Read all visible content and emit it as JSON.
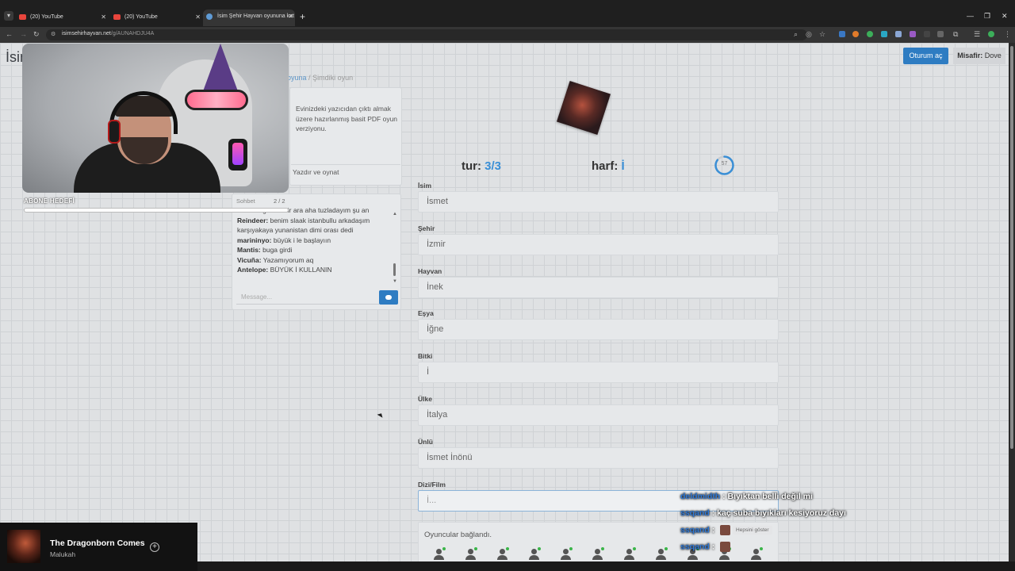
{
  "browser": {
    "tabs": [
      {
        "label": "(20) YouTube"
      },
      {
        "label": "(20) YouTube"
      },
      {
        "label": "İsim Şehir Hayvan oyununa kat"
      }
    ],
    "url_domain": "isimsehirhayvan.net",
    "url_path": "/g/AUNAHDJU4A"
  },
  "site": {
    "brand": "İsim",
    "login_label": "Oturum aç",
    "guest_prefix": "Misafir:",
    "guest_name": "Dove"
  },
  "breadcrumb": {
    "link": "oyuna",
    "separator": "/",
    "current": "Şimdiki oyun"
  },
  "pdf_card": {
    "text": "Evinizdeki yazıcıdan çıktı almak üzere hazırlanmış basit PDF oyun verziyonu.",
    "button": "Yazdır ve oynat"
  },
  "game": {
    "round_label": "tur:",
    "round_value": "3/3",
    "letter_label": "harf:",
    "letter_value": "İ",
    "timer": "57",
    "timer_fraction": 0.85,
    "fields": [
      {
        "label": "İsim",
        "value": "İsmet"
      },
      {
        "label": "Şehir",
        "value": "İzmir"
      },
      {
        "label": "Hayvan",
        "value": "İnek"
      },
      {
        "label": "Eşya",
        "value": "İğne"
      },
      {
        "label": "Bitki",
        "value": "İ"
      },
      {
        "label": "Ülke",
        "value": "İtalya"
      },
      {
        "label": "Ünlü",
        "value": "İsmet İnönü"
      },
      {
        "label": "Dizi/Film",
        "value": "İ..."
      }
    ],
    "players_status": "Oyuncular bağlandı."
  },
  "chat": {
    "header": "Sohbet",
    "count": "2 / 2",
    "lines": [
      {
        "user": "",
        "text": "smash uğrarım bir ara aha tuzladayım şu an"
      },
      {
        "user": "Reindeer:",
        "text": "benim slaak istanbullu arkadaşım karşıyakaya yunanistan dimi orası dedi"
      },
      {
        "user": "marininyo:",
        "text": "büyük i le başlayıın"
      },
      {
        "user": "Mantis:",
        "text": "buga girdi"
      },
      {
        "user": "Vicuña:",
        "text": "Yazamıyorum aq"
      },
      {
        "user": "Antelope:",
        "text": "BÜYÜK İ KULLANIN"
      }
    ],
    "placeholder": "Message..."
  },
  "stream": {
    "sub_goal": "ABONE HEDEFİ",
    "twitch_chat": [
      {
        "user": "deldmidth",
        "sep": ":",
        "text": "Bıyıktan belli değil mi"
      },
      {
        "user": "ssqand",
        "sep": ":",
        "text": "kaç suba bıyıkları kesiyoruz dayı"
      },
      {
        "user": "ssqand",
        "sep": ":",
        "text": "",
        "chip": "Hepsini göster"
      },
      {
        "user": "ssqand",
        "sep": ":",
        "text": ""
      }
    ]
  },
  "spotify": {
    "title": "The Dragonborn Comes",
    "artist": "Malukah"
  },
  "colors": {
    "accent": "#2e7cc2",
    "highlight": "#3a8fd6",
    "online": "#3bb54a"
  }
}
